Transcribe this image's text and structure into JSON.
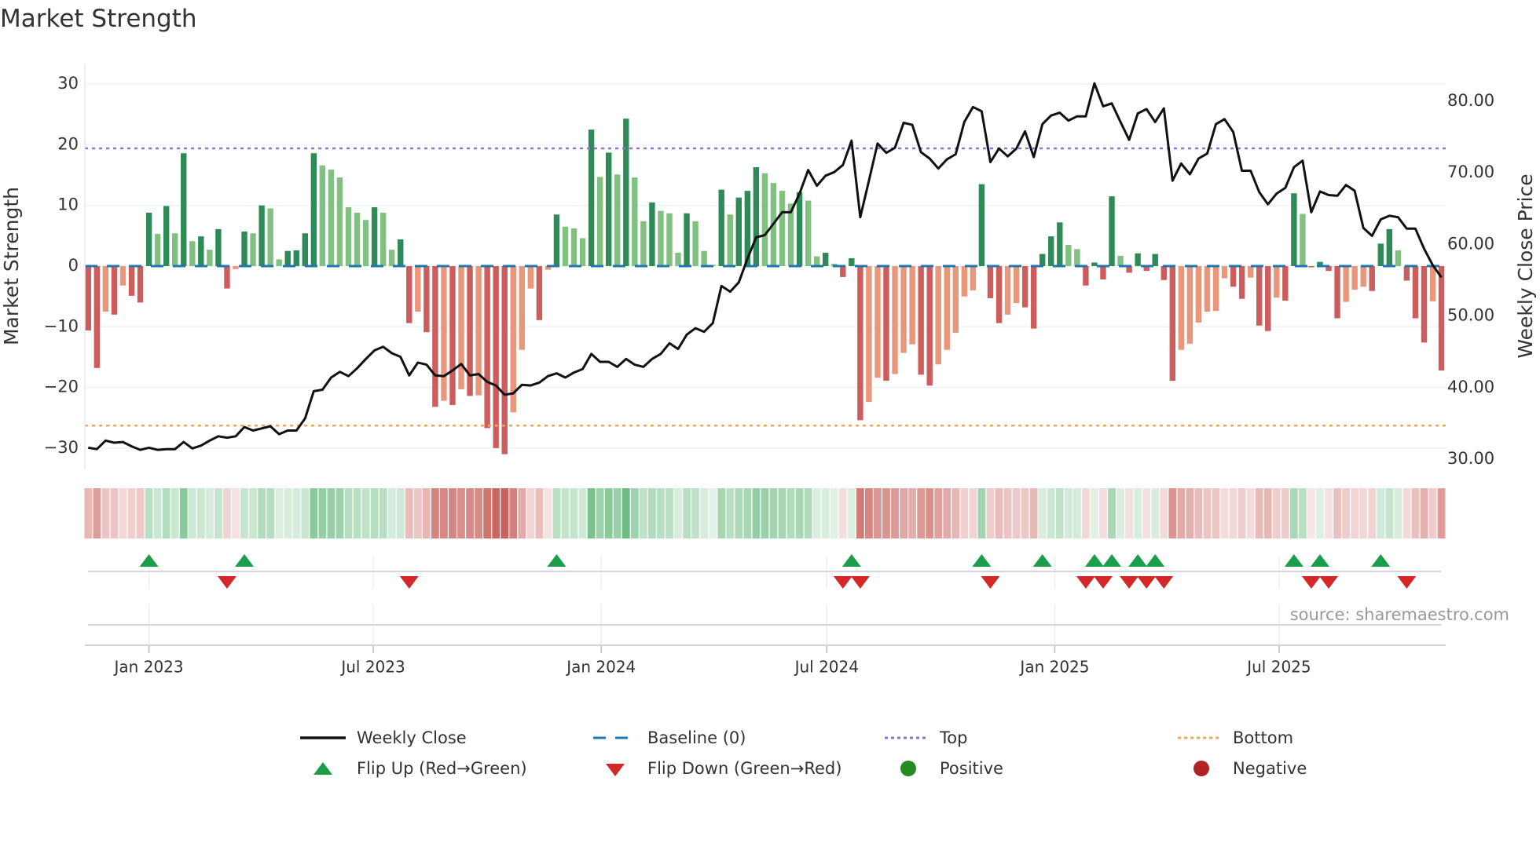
{
  "title": "Market Strength",
  "chart_data": {
    "type": "bar",
    "overlay_type": "line",
    "title": "Market Strength",
    "ylabel": "Market Strength",
    "y2label": "Weekly Close Price",
    "ylim": [
      -33,
      33
    ],
    "y2lim": [
      27.5,
      84
    ],
    "x_start": "2022-11-13",
    "x_step_days": 7,
    "yticks": [
      30,
      20,
      10,
      0,
      -10,
      -20,
      -30
    ],
    "ytick_labels": [
      "30",
      "20",
      "10",
      "0",
      "−10",
      "−20",
      "−30"
    ],
    "y2ticks": [
      80,
      70,
      60,
      50,
      40,
      30
    ],
    "y2tick_labels": [
      "80.00",
      "70.00",
      "60.00",
      "50.00",
      "40.00",
      "30.00"
    ],
    "xticks": [
      {
        "date": "2023-01-01",
        "label": "Jan 2023"
      },
      {
        "date": "2023-07-01",
        "label": "Jul 2023"
      },
      {
        "date": "2024-01-01",
        "label": "Jan 2024"
      },
      {
        "date": "2024-07-01",
        "label": "Jul 2024"
      },
      {
        "date": "2025-01-01",
        "label": "Jan 2025"
      },
      {
        "date": "2025-07-01",
        "label": "Jul 2025"
      }
    ],
    "top_level": 19.4,
    "bottom_level": -26.3,
    "baseline": 0,
    "strength": [
      -10.6,
      -16.8,
      -7.5,
      -8.0,
      -3.2,
      -4.9,
      -6.0,
      8.8,
      5.3,
      9.9,
      5.4,
      18.6,
      4.1,
      4.9,
      2.7,
      6.1,
      -3.7,
      -0.5,
      5.7,
      5.4,
      10.0,
      9.5,
      1.1,
      2.5,
      2.6,
      5.4,
      18.6,
      16.6,
      15.9,
      14.6,
      9.7,
      8.8,
      7.6,
      9.7,
      8.8,
      2.7,
      4.4,
      -9.4,
      -7.5,
      -10.9,
      -23.2,
      -22.2,
      -22.9,
      -20.3,
      -21.4,
      -21.3,
      -26.7,
      -30.0,
      -31.0,
      -24.1,
      -13.8,
      -3.7,
      -8.9,
      -0.6,
      8.5,
      6.5,
      6.2,
      4.6,
      22.5,
      14.7,
      18.7,
      15.1,
      24.3,
      14.6,
      7.4,
      10.5,
      9.1,
      8.7,
      2.2,
      8.7,
      7.4,
      2.5,
      0.2,
      12.6,
      8.5,
      11.3,
      12.4,
      16.3,
      15.3,
      13.7,
      12.4,
      10.3,
      12.2,
      10.8,
      1.6,
      2.2,
      0.4,
      -1.8,
      1.3,
      -25.4,
      -22.4,
      -18.4,
      -18.9,
      -17.8,
      -14.3,
      -12.9,
      -17.9,
      -19.7,
      -16.2,
      -13.8,
      -11.0,
      -5.0,
      -4.0,
      13.5,
      -5.3,
      -9.4,
      -8.0,
      -6.1,
      -6.8,
      -10.3,
      2.0,
      4.9,
      7.2,
      3.5,
      2.8,
      -3.2,
      0.6,
      -2.2,
      11.5,
      1.7,
      -1.1,
      2.1,
      -0.8,
      2.0,
      -2.3,
      -18.9,
      -13.8,
      -12.8,
      -9.3,
      -7.5,
      -7.4,
      -2.0,
      -3.4,
      -5.4,
      -1.9,
      -9.8,
      -10.7,
      -5.2,
      -5.7,
      12.0,
      8.6,
      -0.2,
      0.7,
      -0.8,
      -8.6,
      -5.9,
      -3.9,
      -3.4,
      -4.1,
      3.7,
      6.1,
      2.6,
      -2.4,
      -8.6,
      -12.6,
      -5.8,
      -17.2
    ],
    "weekly_close": [
      31.6,
      31.4,
      32.6,
      32.3,
      32.4,
      31.8,
      31.3,
      31.6,
      31.3,
      31.4,
      31.4,
      32.4,
      31.5,
      31.9,
      32.6,
      33.2,
      33.0,
      33.2,
      34.5,
      34.0,
      34.3,
      34.6,
      33.5,
      34.0,
      34.0,
      35.7,
      39.5,
      39.7,
      41.4,
      42.2,
      41.6,
      42.7,
      44.0,
      45.2,
      45.7,
      44.8,
      44.3,
      41.7,
      43.5,
      43.2,
      41.7,
      41.6,
      42.4,
      43.3,
      41.7,
      41.9,
      40.8,
      40.3,
      39.0,
      39.2,
      40.4,
      40.3,
      40.7,
      41.6,
      42.0,
      41.4,
      42.1,
      42.6,
      44.7,
      43.6,
      43.6,
      42.9,
      44.0,
      43.2,
      42.9,
      44.0,
      44.7,
      46.2,
      45.4,
      47.4,
      48.3,
      47.8,
      49.0,
      54.2,
      53.4,
      54.7,
      58.0,
      61.0,
      61.3,
      62.9,
      64.5,
      64.5,
      67.1,
      70.4,
      68.2,
      69.6,
      70.1,
      71.1,
      74.5,
      63.8,
      68.9,
      74.1,
      72.8,
      73.5,
      77.0,
      76.7,
      72.9,
      72.0,
      70.6,
      71.9,
      72.6,
      77.1,
      79.2,
      78.6,
      71.5,
      73.4,
      72.3,
      73.4,
      75.8,
      72.2,
      76.8,
      78.0,
      78.4,
      77.3,
      77.9,
      77.9,
      82.5,
      79.3,
      79.7,
      77.1,
      74.6,
      78.3,
      78.9,
      77.1,
      79.0,
      68.9,
      71.3,
      69.8,
      72.0,
      72.7,
      76.8,
      77.5,
      75.7,
      70.3,
      70.3,
      67.3,
      65.6,
      67.1,
      67.9,
      70.8,
      71.7,
      64.5,
      67.4,
      66.9,
      66.8,
      68.3,
      67.5,
      62.3,
      61.2,
      63.5,
      64.0,
      63.8,
      62.2,
      62.2,
      59.4,
      57.1,
      55.4
    ],
    "source": "source: sharemaestro.com",
    "legend": [
      {
        "label": "Weekly Close",
        "symbol": "line"
      },
      {
        "label": "Baseline (0)",
        "symbol": "dash"
      },
      {
        "label": "Top",
        "symbol": "dot-purple"
      },
      {
        "label": "Bottom",
        "symbol": "dot-orange"
      },
      {
        "label": "Flip Up (Red→Green)",
        "symbol": "triangle-up"
      },
      {
        "label": "Flip Down (Green→Red)",
        "symbol": "triangle-down"
      },
      {
        "label": "Positive",
        "symbol": "circle-green"
      },
      {
        "label": "Negative",
        "symbol": "circle-red"
      }
    ],
    "legend_position": "bottom-center",
    "grid": true,
    "colors": {
      "pos_strong": "#2e8b57",
      "pos_weak": "#80c080",
      "neg_strong": "#cd5c5c",
      "neg_weak": "#e9967a",
      "line": "#111111",
      "baseline": "#1f77b4",
      "top": "#9370db",
      "bottom": "#f4a460",
      "flip_up": "#1a9e4a",
      "flip_down": "#d62728",
      "positive": "#228b22",
      "negative": "#b22222"
    }
  }
}
